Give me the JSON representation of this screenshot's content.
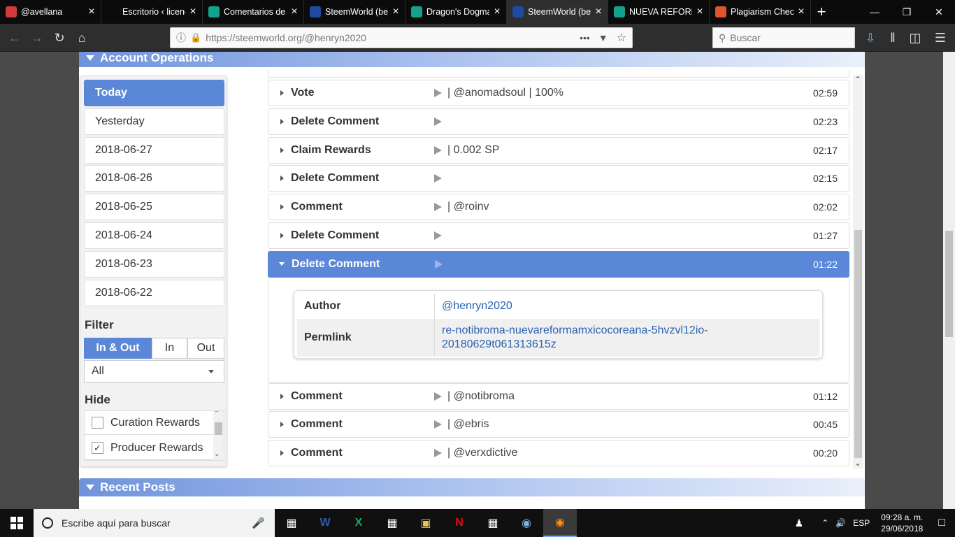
{
  "browser": {
    "tabs": [
      {
        "label": "@avellana",
        "favicon_color": "#d33b3b"
      },
      {
        "label": "Escritorio ‹ licenciado",
        "favicon_color": "#0b0b0b"
      },
      {
        "label": "Comentarios de",
        "favicon_color": "#13a38c"
      },
      {
        "label": "SteemWorld (be",
        "favicon_color": "#1f4aa3"
      },
      {
        "label": "Dragon's Dogma",
        "favicon_color": "#13a38c"
      },
      {
        "label": "SteemWorld (be",
        "favicon_color": "#1f4aa3",
        "active": true
      },
      {
        "label": "NUEVA REFORMA",
        "favicon_color": "#13a38c"
      },
      {
        "label": "Plagiarism Chec",
        "favicon_color": "#e0532d"
      }
    ],
    "url": "https://steemworld.org/@henryn2020",
    "search_placeholder": "Buscar"
  },
  "panels": {
    "account_operations": "Account Operations",
    "recent_posts": "Recent Posts"
  },
  "sidebar": {
    "dates": [
      "Today",
      "Yesterday",
      "2018-06-27",
      "2018-06-26",
      "2018-06-25",
      "2018-06-24",
      "2018-06-23",
      "2018-06-22"
    ],
    "active_index": 0,
    "filter_label": "Filter",
    "filter_tabs": [
      "In & Out",
      "In",
      "Out"
    ],
    "filter_select": "All",
    "hide_label": "Hide",
    "hide_items": [
      {
        "label": "Curation Rewards",
        "checked": false
      },
      {
        "label": "Producer Rewards",
        "checked": true
      }
    ]
  },
  "operations": [
    {
      "type": "Vote",
      "detail": "| @anomadsoul | 100%",
      "time": "02:59"
    },
    {
      "type": "Delete Comment",
      "detail": "",
      "time": "02:23"
    },
    {
      "type": "Claim Rewards",
      "detail": "| 0.002 SP",
      "time": "02:17"
    },
    {
      "type": "Delete Comment",
      "detail": "",
      "time": "02:15"
    },
    {
      "type": "Comment",
      "detail": "| @roinv",
      "time": "02:02"
    },
    {
      "type": "Delete Comment",
      "detail": "",
      "time": "01:27"
    },
    {
      "type": "Delete Comment",
      "detail": "",
      "time": "01:22",
      "expanded": true
    },
    {
      "type": "Comment",
      "detail": "| @notibroma",
      "time": "01:12"
    },
    {
      "type": "Comment",
      "detail": "| @ebris",
      "time": "00:45"
    },
    {
      "type": "Comment",
      "detail": "| @verxdictive",
      "time": "00:20"
    }
  ],
  "expanded_detail": {
    "author_key": "Author",
    "author_val": "@henryn2020",
    "permlink_key": "Permlink",
    "permlink_val_1": "re-notibroma-nuevareformamxicocoreana-5hvzvl12io-",
    "permlink_val_2": "20180629t061313615z"
  },
  "taskbar": {
    "search_placeholder": "Escribe aquí para buscar",
    "language": "ESP",
    "time": "09:28 a. m.",
    "date": "29/06/2018"
  }
}
